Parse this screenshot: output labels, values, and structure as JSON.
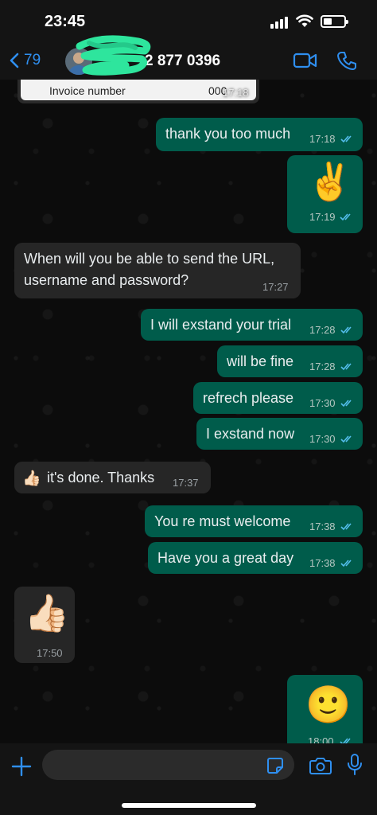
{
  "status_bar": {
    "time": "23:45"
  },
  "header": {
    "back_count": "79",
    "contact_number": "2 877 0396"
  },
  "chat": {
    "document_preview": {
      "label": "Invoice number",
      "number": "000",
      "time": "17:18"
    },
    "messages": [
      {
        "dir": "out",
        "text": "thank you too much",
        "time": "17:18"
      },
      {
        "dir": "out",
        "emoji": "✌️",
        "time": "17:19"
      },
      {
        "dir": "in",
        "text_lines": [
          "When will you be able to send the URL,",
          "username and password?"
        ],
        "time": "17:27"
      },
      {
        "dir": "out",
        "text": "I will exstand your trial",
        "time": "17:28"
      },
      {
        "dir": "out",
        "text": "will be fine",
        "time": "17:28"
      },
      {
        "dir": "out",
        "text": "refrech please",
        "time": "17:30"
      },
      {
        "dir": "out",
        "text": "I exstand now",
        "time": "17:30"
      },
      {
        "dir": "in",
        "emoji": "👍🏻",
        "text": "it's done. Thanks",
        "time": "17:37"
      },
      {
        "dir": "out",
        "text": "You re must welcome",
        "time": "17:38"
      },
      {
        "dir": "out",
        "text": "Have you a great day",
        "time": "17:38"
      },
      {
        "dir": "in",
        "emoji": "👍🏻",
        "time": "17:50"
      },
      {
        "dir": "out",
        "emoji": "🙂",
        "time": "18:00"
      }
    ]
  },
  "colors": {
    "accent": "#2f8ff0",
    "outgoing_bubble": "#005c4b",
    "incoming_bubble": "#262626",
    "read_tick": "#53bdeb"
  },
  "icons": [
    "chevron-left-icon",
    "video-call-icon",
    "phone-icon",
    "plus-icon",
    "sticker-icon",
    "camera-icon",
    "microphone-icon",
    "double-check-icon"
  ]
}
